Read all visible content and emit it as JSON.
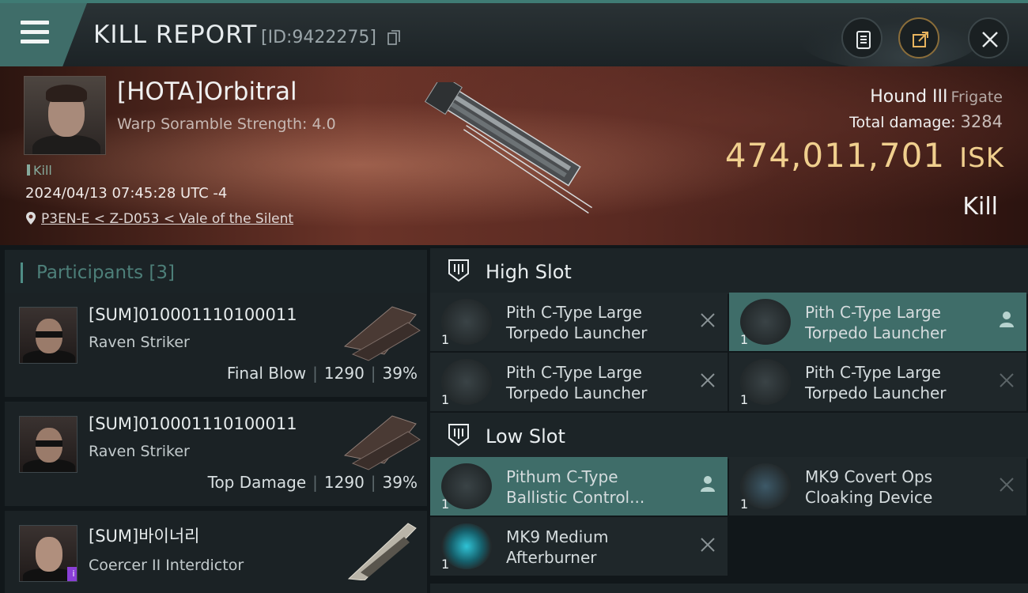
{
  "titlebar": {
    "title": "KILL REPORT",
    "report_id": "[ID:9422275]",
    "icons": [
      "menu-icon",
      "copy-icon",
      "clipboard-icon",
      "share-icon",
      "close-icon"
    ]
  },
  "header": {
    "pilot_name": "[HOTA]Orbitral",
    "scramble": "Warp Soramble Strength: 4.0",
    "kill_tag": "Kill",
    "datetime": "2024/04/13 07:45:28 UTC -4",
    "location": "P3EN-E < Z-D053 < Vale of the Silent",
    "ship_name": "Hound III",
    "ship_class": "Frigate",
    "total_damage_label": "Total damage:",
    "total_damage": "3284",
    "isk_value": "474,011,701",
    "isk_unit": "ISK",
    "result": "Kill"
  },
  "participants": {
    "label": "Participants",
    "count": "[3]",
    "rows": [
      {
        "name": "[SUM]010001110100011",
        "ship": "Raven Striker",
        "role": "Final Blow",
        "damage": "1290",
        "percent": "39%"
      },
      {
        "name": "[SUM]010001110100011",
        "ship": "Raven Striker",
        "role": "Top Damage",
        "damage": "1290",
        "percent": "39%"
      },
      {
        "name": "[SUM]바이너리",
        "ship": "Coercer II Interdictor",
        "badge": "i"
      }
    ]
  },
  "high_slot": {
    "label": "High Slot",
    "modules": [
      {
        "line1": "Pith C-Type Large",
        "line2": "Torpedo Launcher",
        "qty": "1"
      },
      {
        "line1": "Pith C-Type Large",
        "line2": "Torpedo Launcher",
        "qty": "1"
      },
      {
        "line1": "Pith C-Type Large",
        "line2": "Torpedo Launcher",
        "qty": "1"
      },
      {
        "line1": "Pith C-Type Large",
        "line2": "Torpedo Launcher",
        "qty": "1"
      }
    ]
  },
  "low_slot": {
    "label": "Low Slot",
    "modules": [
      {
        "line1": "Pithum C-Type",
        "line2": "Ballistic Control...",
        "qty": "1"
      },
      {
        "line1": "MK9 Covert Ops",
        "line2": "Cloaking Device",
        "qty": "1"
      },
      {
        "line1": "MK9 Medium",
        "line2": "Afterburner",
        "qty": "1"
      }
    ]
  },
  "colors": {
    "accent": "#3f6d69",
    "isk": "#f0cf8e",
    "header_bg": "#5a2a22"
  }
}
